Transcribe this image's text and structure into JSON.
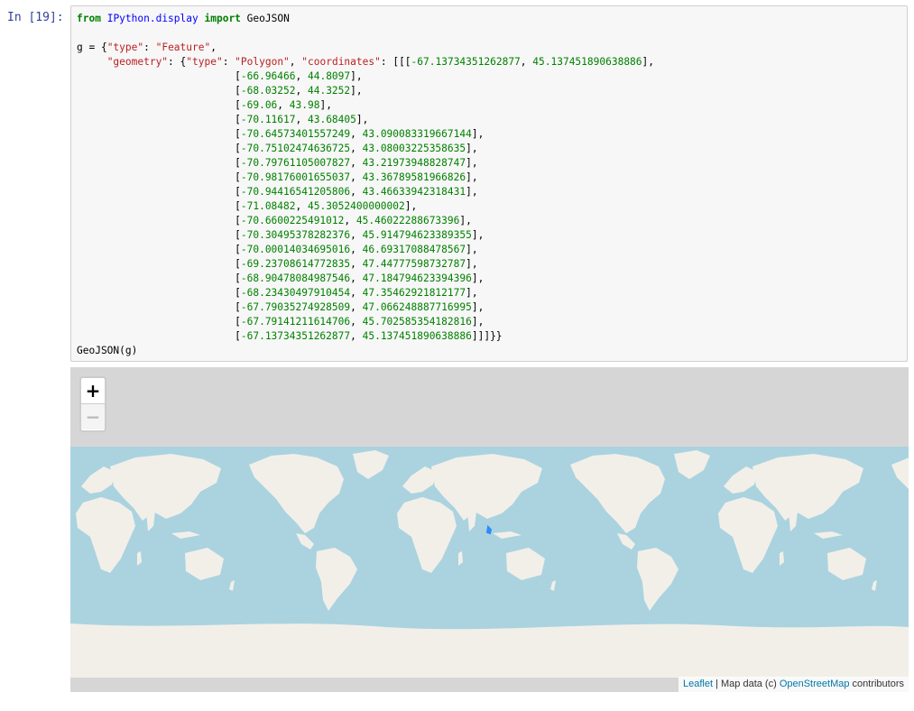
{
  "cell": {
    "prompt": "In [19]:",
    "kw_from": "from",
    "module": "IPython.display",
    "kw_import": "import",
    "import_name": "GeoJSON",
    "var_decl": "g = {",
    "key_type": "\"type\"",
    "val_feature": "\"Feature\"",
    "key_geometry": "\"geometry\"",
    "val_polygon": "\"Polygon\"",
    "key_coordinates": "\"coordinates\"",
    "coordinates": [
      [
        "-67.13734351262877",
        "45.137451890638886"
      ],
      [
        "-66.96466",
        "44.8097"
      ],
      [
        "-68.03252",
        "44.3252"
      ],
      [
        "-69.06",
        "43.98"
      ],
      [
        "-70.11617",
        "43.68405"
      ],
      [
        "-70.64573401557249",
        "43.090083319667144"
      ],
      [
        "-70.75102474636725",
        "43.08003225358635"
      ],
      [
        "-70.79761105007827",
        "43.21973948828747"
      ],
      [
        "-70.98176001655037",
        "43.36789581966826"
      ],
      [
        "-70.94416541205806",
        "43.46633942318431"
      ],
      [
        "-71.08482",
        "45.3052400000002"
      ],
      [
        "-70.6600225491012",
        "45.46022288673396"
      ],
      [
        "-70.30495378282376",
        "45.914794623389355"
      ],
      [
        "-70.00014034695016",
        "46.69317088478567"
      ],
      [
        "-69.23708614772835",
        "47.44777598732787"
      ],
      [
        "-68.90478084987546",
        "47.184794623394396"
      ],
      [
        "-68.23430497910454",
        "47.35462921812177"
      ],
      [
        "-67.79035274928509",
        "47.066248887716995"
      ],
      [
        "-67.79141211614706",
        "45.702585354182816"
      ],
      [
        "-67.13734351262877",
        "45.137451890638886"
      ]
    ],
    "last_line": "GeoJSON(g)"
  },
  "map": {
    "zoom_in": "+",
    "zoom_out": "−",
    "attribution": {
      "leaflet": "Leaflet",
      "separator": " | Map data (c) ",
      "osm": "OpenStreetMap",
      "suffix": " contributors"
    },
    "colors": {
      "ocean": "#aad3df",
      "land": "#f2efe9",
      "background": "#d6d6d6",
      "feature": "#3388ff"
    }
  }
}
